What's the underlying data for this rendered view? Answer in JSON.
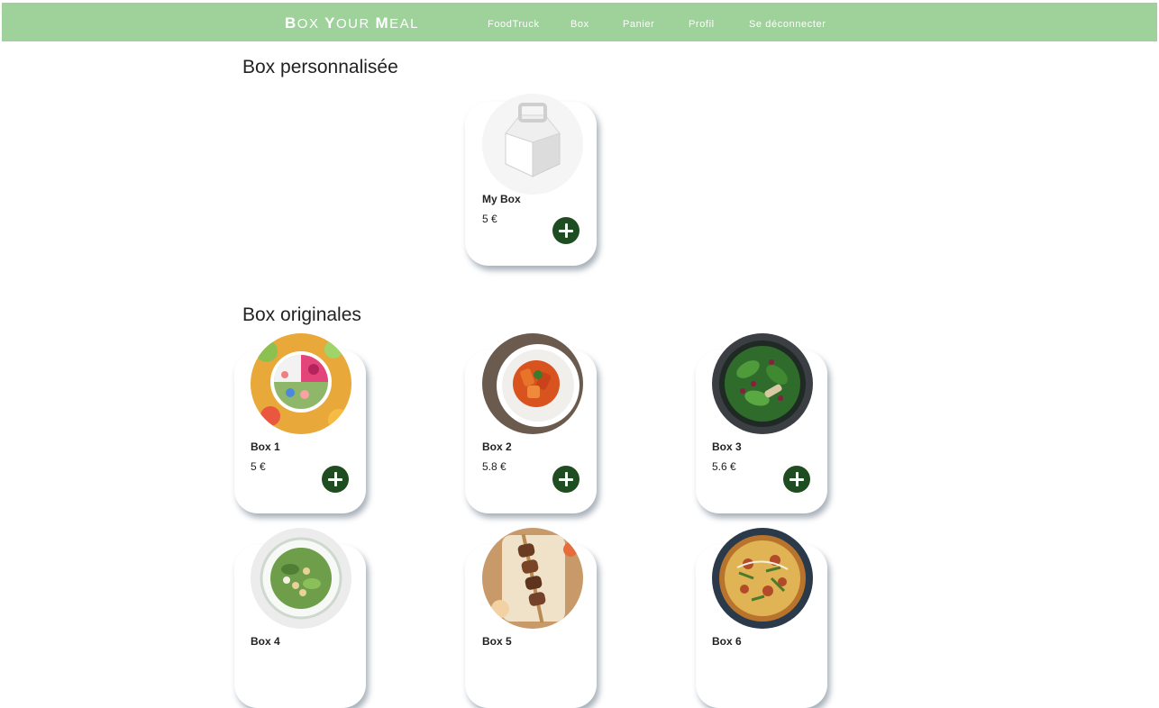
{
  "header": {
    "brand": {
      "b1": "B",
      "r1": "OX ",
      "b2": "Y",
      "r2": "OUR ",
      "b3": "M",
      "r3": "EAL"
    },
    "nav": [
      "FoodTruck",
      "Box",
      "Panier",
      "Profil",
      "Se déconnecter"
    ]
  },
  "custom_section": {
    "title": "Box personnalisée",
    "item": {
      "name": "My Box",
      "price": "5 €",
      "image_icon": "gift-box-icon"
    }
  },
  "original_section": {
    "title": "Box originales",
    "items": [
      {
        "name": "Box 1",
        "price": "5 €",
        "image_icon": "smoothie-bowl-icon"
      },
      {
        "name": "Box 2",
        "price": "5.8 €",
        "image_icon": "pasta-plate-icon"
      },
      {
        "name": "Box 3",
        "price": "5.6 €",
        "image_icon": "salad-bowl-icon"
      },
      {
        "name": "Box 4",
        "price": "",
        "image_icon": "chickpea-salad-icon"
      },
      {
        "name": "Box 5",
        "price": "",
        "image_icon": "kebab-skewers-icon"
      },
      {
        "name": "Box 6",
        "price": "",
        "image_icon": "pizza-icon"
      }
    ]
  },
  "colors": {
    "header_bg": "#9fd19b",
    "button_bg": "#1e4d22",
    "text": "#222222"
  }
}
